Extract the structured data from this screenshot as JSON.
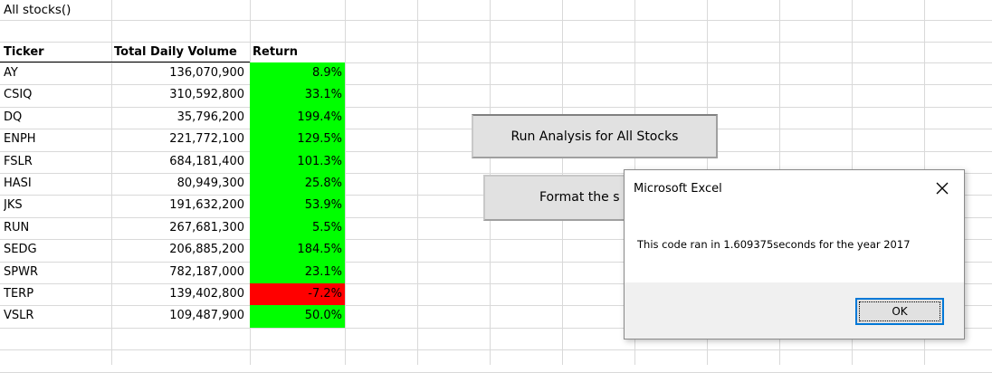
{
  "sheet": {
    "title": "All stocks()",
    "headers": {
      "ticker": "Ticker",
      "volume": "Total Daily Volume",
      "return": "Return"
    },
    "rows": [
      {
        "ticker": "AY",
        "volume": "136,070,900",
        "return": "8.9%",
        "status": "pos"
      },
      {
        "ticker": "CSIQ",
        "volume": "310,592,800",
        "return": "33.1%",
        "status": "pos"
      },
      {
        "ticker": "DQ",
        "volume": "35,796,200",
        "return": "199.4%",
        "status": "pos"
      },
      {
        "ticker": "ENPH",
        "volume": "221,772,100",
        "return": "129.5%",
        "status": "pos"
      },
      {
        "ticker": "FSLR",
        "volume": "684,181,400",
        "return": "101.3%",
        "status": "pos"
      },
      {
        "ticker": "HASI",
        "volume": "80,949,300",
        "return": "25.8%",
        "status": "pos"
      },
      {
        "ticker": "JKS",
        "volume": "191,632,200",
        "return": "53.9%",
        "status": "pos"
      },
      {
        "ticker": "RUN",
        "volume": "267,681,300",
        "return": "5.5%",
        "status": "pos"
      },
      {
        "ticker": "SEDG",
        "volume": "206,885,200",
        "return": "184.5%",
        "status": "pos"
      },
      {
        "ticker": "SPWR",
        "volume": "782,187,000",
        "return": "23.1%",
        "status": "pos"
      },
      {
        "ticker": "TERP",
        "volume": "139,402,800",
        "return": "-7.2%",
        "status": "neg"
      },
      {
        "ticker": "VSLR",
        "volume": "109,487,900",
        "return": "50.0%",
        "status": "pos"
      }
    ]
  },
  "colors": {
    "positive": "#00ff00",
    "negative": "#ff0000",
    "accent": "#0078d7"
  },
  "buttons": {
    "run_label": "Run Analysis for All Stocks",
    "format_label": "Format the s"
  },
  "dialog": {
    "title": "Microsoft Excel",
    "message": "This code ran in 1.609375seconds for the year 2017",
    "ok_label": "OK",
    "close_icon": "close-icon"
  }
}
